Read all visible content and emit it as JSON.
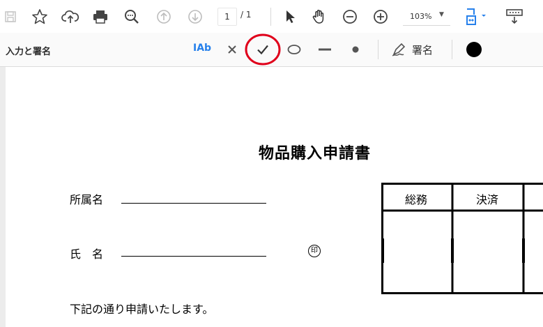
{
  "toolbar": {
    "page_current": "1",
    "page_total": "/ 1",
    "zoom_value": "103%",
    "zoom_arrow": "▼"
  },
  "sign_panel": {
    "title": "入力と署名",
    "text_tool_label": "IAb",
    "sign_label": "署名",
    "fill_color": "#000000",
    "highlight_ring_color": "#e0001b"
  },
  "document": {
    "title": "物品購入申請書",
    "dept_label": "所属名",
    "name_label": "氏　名",
    "seal_mark": "印",
    "body_text": "下記の通り申請いたします。",
    "approval_headers": [
      "総務",
      "決済"
    ]
  }
}
